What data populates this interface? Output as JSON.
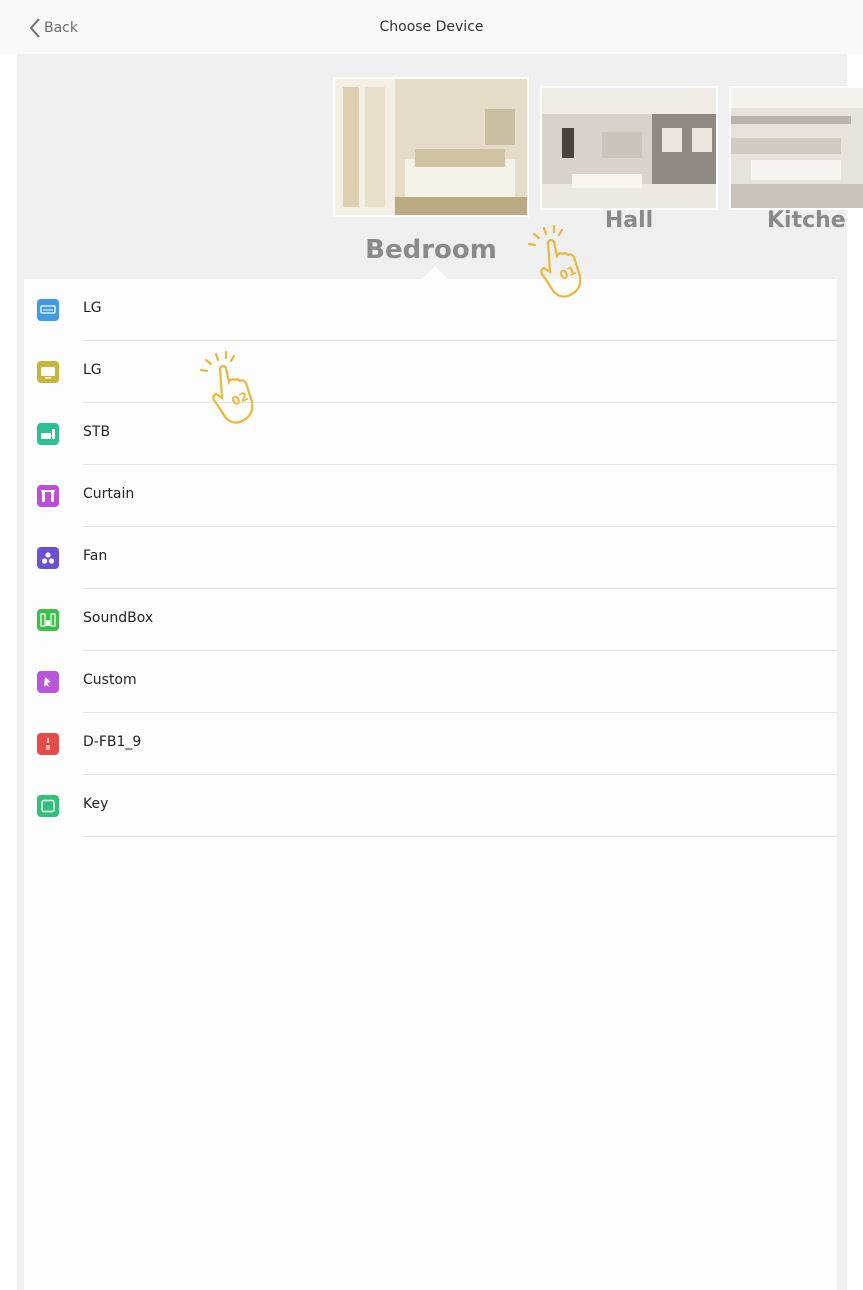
{
  "nav": {
    "back_label": "Back",
    "title": "Choose Device"
  },
  "rooms": [
    {
      "name": "Bedroom",
      "selected": true
    },
    {
      "name": "Hall",
      "selected": false
    },
    {
      "name": "Kitche",
      "selected": false
    }
  ],
  "devices": [
    {
      "name": "LG",
      "icon": "air-conditioner-icon",
      "color": "#3f9be8"
    },
    {
      "name": "LG",
      "icon": "tv-icon",
      "color": "#c9b43a"
    },
    {
      "name": "STB",
      "icon": "set-top-box-icon",
      "color": "#2fbf97"
    },
    {
      "name": "Curtain",
      "icon": "curtain-icon",
      "color": "#c04ad9"
    },
    {
      "name": "Fan",
      "icon": "fan-icon",
      "color": "#6b4fd6"
    },
    {
      "name": "SoundBox",
      "icon": "speaker-icon",
      "color": "#3cc04a"
    },
    {
      "name": "Custom",
      "icon": "custom-icon",
      "color": "#b855d9"
    },
    {
      "name": "D-FB1_9",
      "icon": "switch-icon",
      "color": "#e84a4a"
    },
    {
      "name": "Key",
      "icon": "key-icon",
      "color": "#2fc27a"
    }
  ],
  "annotations": [
    {
      "step": "01",
      "color": "#e8b93a"
    },
    {
      "step": "02",
      "color": "#e8b93a"
    }
  ]
}
